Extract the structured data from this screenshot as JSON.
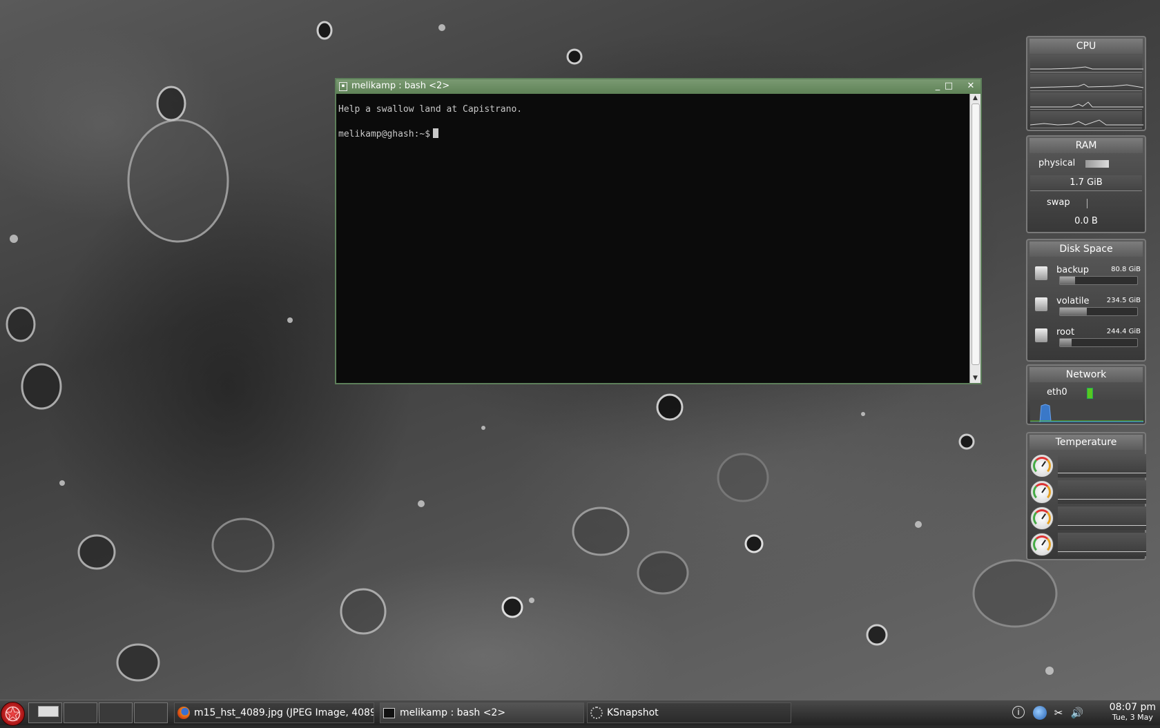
{
  "terminal": {
    "title": "melikamp : bash <2>",
    "lines": [
      "Help a swallow land at Capistrano.",
      "",
      "melikamp@ghash:~$"
    ],
    "buttons": {
      "minimize": "_",
      "maximize": "□",
      "close": "✕"
    }
  },
  "widgets": {
    "cpu": {
      "title": "CPU",
      "graph_count": 4
    },
    "ram": {
      "title": "RAM",
      "physical_label": "physical",
      "physical_value": "1.7 GiB",
      "physical_fraction": 0.45,
      "swap_label": "swap",
      "swap_value": "0.0 B",
      "swap_fraction": 0.0
    },
    "disk": {
      "title": "Disk Space",
      "items": [
        {
          "name": "backup",
          "size": "80.8 GiB",
          "fraction": 0.2
        },
        {
          "name": "volatile",
          "size": "234.5 GiB",
          "fraction": 0.35
        },
        {
          "name": "root",
          "size": "244.4 GiB",
          "fraction": 0.15
        }
      ]
    },
    "network": {
      "title": "Network",
      "interface": "eth0"
    },
    "temperature": {
      "title": "Temperature",
      "sensor_count": 4
    }
  },
  "taskbar": {
    "pager_count": 4,
    "active_desktop": 1,
    "tasks": [
      {
        "label": "m15_hst_4089.jpg (JPEG Image, 4089",
        "icon": "firefox-icon"
      },
      {
        "label": "melikamp : bash <2>",
        "icon": "terminal-icon"
      },
      {
        "label": "KSnapshot",
        "icon": "ksnapshot-icon"
      }
    ],
    "tray": [
      "info-icon",
      "network-manager-icon",
      "klipper-scissors-icon",
      "volume-icon"
    ],
    "clock": {
      "time": "08:07 pm",
      "date": "Tue, 3 May"
    }
  },
  "colors": {
    "terminal_border": "#5d7f5a",
    "network_accent": "#58c820",
    "network_graph": "#3a78c8"
  }
}
